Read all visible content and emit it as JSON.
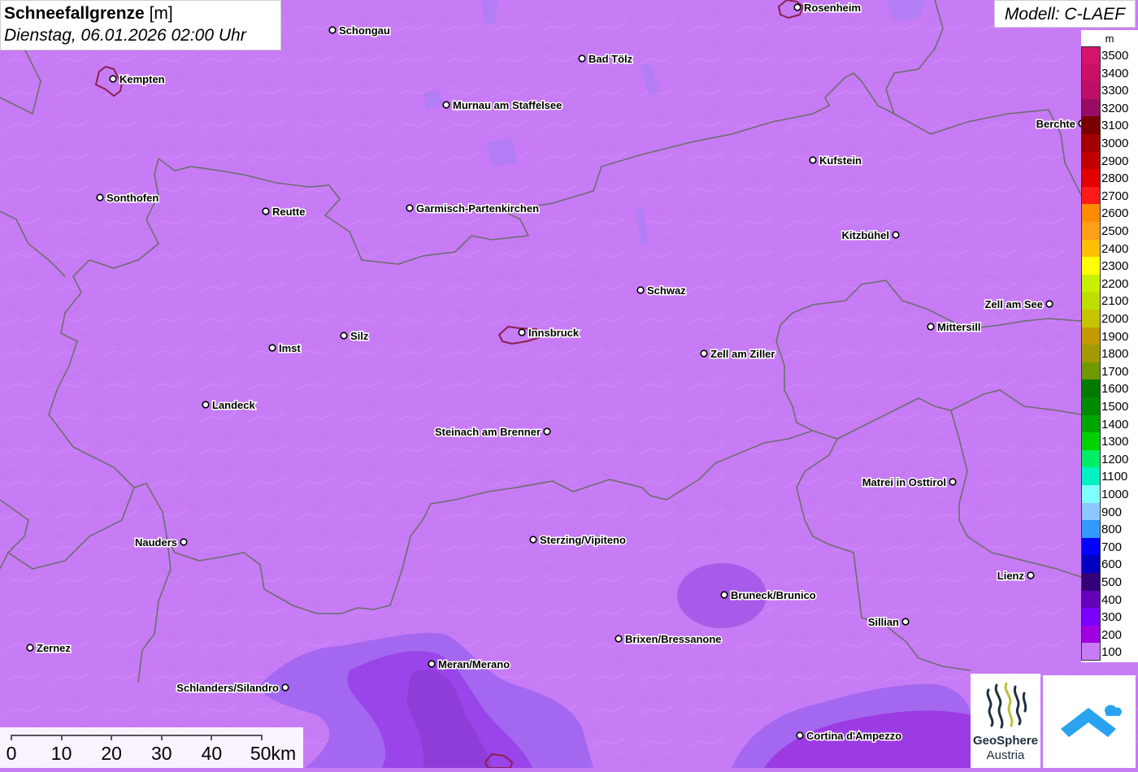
{
  "header": {
    "title": "Schneefallgrenze",
    "unit": "[m]",
    "datetime": "Dienstag, 06.01.2026 02:00 Uhr"
  },
  "model": {
    "label": "Modell: C-LAEF"
  },
  "legend": {
    "unit": "m",
    "classes": [
      {
        "label": "3500",
        "color": "#d4136c"
      },
      {
        "label": "3400",
        "color": "#cc0f66"
      },
      {
        "label": "3300",
        "color": "#bd0f66"
      },
      {
        "label": "3200",
        "color": "#990c66"
      },
      {
        "label": "3100",
        "color": "#7a0000"
      },
      {
        "label": "3000",
        "color": "#a30000"
      },
      {
        "label": "2900",
        "color": "#c00000"
      },
      {
        "label": "2800",
        "color": "#e10000"
      },
      {
        "label": "2700",
        "color": "#ff1a1a"
      },
      {
        "label": "2600",
        "color": "#ff8c00"
      },
      {
        "label": "2500",
        "color": "#ff9f1a"
      },
      {
        "label": "2400",
        "color": "#ffbf00"
      },
      {
        "label": "2300",
        "color": "#ffff00"
      },
      {
        "label": "2200",
        "color": "#c8f000"
      },
      {
        "label": "2100",
        "color": "#c0dd00"
      },
      {
        "label": "2000",
        "color": "#c4c400"
      },
      {
        "label": "1900",
        "color": "#c49a00"
      },
      {
        "label": "1800",
        "color": "#a39a00"
      },
      {
        "label": "1700",
        "color": "#6e9a00"
      },
      {
        "label": "1600",
        "color": "#007a00"
      },
      {
        "label": "1500",
        "color": "#008a00"
      },
      {
        "label": "1400",
        "color": "#00a600"
      },
      {
        "label": "1300",
        "color": "#00d100"
      },
      {
        "label": "1200",
        "color": "#00ee66"
      },
      {
        "label": "1100",
        "color": "#00f2c0"
      },
      {
        "label": "1000",
        "color": "#80ffff"
      },
      {
        "label": "900",
        "color": "#8cc8ff"
      },
      {
        "label": "800",
        "color": "#3399ff"
      },
      {
        "label": "700",
        "color": "#0000ff"
      },
      {
        "label": "600",
        "color": "#0000c0"
      },
      {
        "label": "500",
        "color": "#330077"
      },
      {
        "label": "400",
        "color": "#6600bb"
      },
      {
        "label": "300",
        "color": "#7a00ff"
      },
      {
        "label": "200",
        "color": "#a000e0"
      },
      {
        "label": "100",
        "color": "#c77cf6"
      }
    ]
  },
  "places": [
    {
      "name": "Rosenheim",
      "label_side": "right"
    },
    {
      "name": "Schongau",
      "label_side": "right"
    },
    {
      "name": "Bad Tölz",
      "label_side": "right"
    },
    {
      "name": "Kempten",
      "label_side": "right"
    },
    {
      "name": "Murnau am Staffelsee",
      "label_side": "right"
    },
    {
      "name": "Berchte",
      "label_side": "left"
    },
    {
      "name": "Kufstein",
      "label_side": "right"
    },
    {
      "name": "Sonthofen",
      "label_side": "right"
    },
    {
      "name": "Reutte",
      "label_side": "right"
    },
    {
      "name": "Garmisch-Partenkirchen",
      "label_side": "right"
    },
    {
      "name": "Kitzbühel",
      "label_side": "left"
    },
    {
      "name": "Schwaz",
      "label_side": "right"
    },
    {
      "name": "Zell am See",
      "label_side": "left"
    },
    {
      "name": "Mittersill",
      "label_side": "right"
    },
    {
      "name": "Silz",
      "label_side": "right"
    },
    {
      "name": "Innsbruck",
      "label_side": "right"
    },
    {
      "name": "Imst",
      "label_side": "right"
    },
    {
      "name": "Zell am Ziller",
      "label_side": "right"
    },
    {
      "name": "Landeck",
      "label_side": "right"
    },
    {
      "name": "Steinach am Brenner",
      "label_side": "left"
    },
    {
      "name": "Matrei in Osttirol",
      "label_side": "left"
    },
    {
      "name": "Nauders",
      "label_side": "left"
    },
    {
      "name": "Sterzing/Vipiteno",
      "label_side": "right"
    },
    {
      "name": "Lienz",
      "label_side": "left"
    },
    {
      "name": "Bruneck/Brunico",
      "label_side": "right"
    },
    {
      "name": "Sillian",
      "label_side": "left"
    },
    {
      "name": "Brixen/Bressanone",
      "label_side": "right"
    },
    {
      "name": "Zernez",
      "label_side": "right"
    },
    {
      "name": "Meran/Merano",
      "label_side": "right"
    },
    {
      "name": "Schlanders/Silandro",
      "label_side": "left"
    },
    {
      "name": "Cortina d'Ampezzo",
      "label_side": "right"
    }
  ],
  "scalebar": {
    "labels": [
      "0",
      "10",
      "20",
      "30",
      "40",
      "50km"
    ]
  },
  "logos": {
    "geosphere_line1": "GeoSphere",
    "geosphere_line2": "Austria"
  },
  "colors": {
    "base_field": "#c77cf6",
    "field_300": "#a05ff2",
    "field_200": "#9b33e0",
    "border": "#6d6d6d",
    "city_outline": "#8b2050"
  }
}
